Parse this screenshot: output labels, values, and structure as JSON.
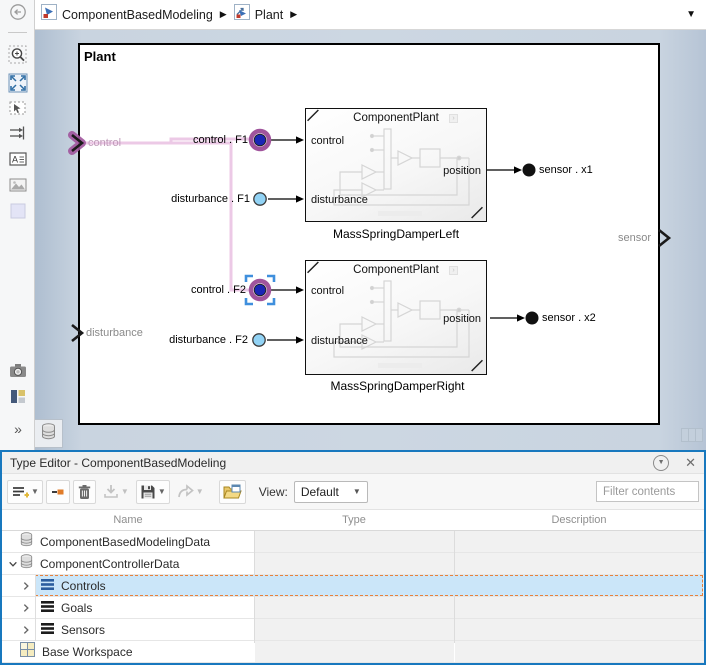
{
  "breadcrumb": {
    "items": [
      {
        "label": "ComponentBasedModeling"
      },
      {
        "label": "Plant"
      }
    ],
    "separator_icon": "▶",
    "dropdown_icon": "▼"
  },
  "left_toolbar": {
    "expand_icon": "»"
  },
  "canvas": {
    "title": "Plant",
    "edge_ports": {
      "input_control": "control",
      "input_disturbance": "disturbance",
      "output_sensor": "sensor"
    },
    "labels": {
      "control_f1": "control . F1",
      "disturbance_f1": "disturbance . F1",
      "sensor_x1": "sensor . x1",
      "control_f2": "control . F2",
      "disturbance_f2": "disturbance . F2",
      "sensor_x2": "sensor . x2"
    },
    "blocks": [
      {
        "title": "ComponentPlant",
        "caption": "MassSpringDamperLeft",
        "ports": {
          "in1": "control",
          "in2": "disturbance",
          "out": "position"
        }
      },
      {
        "title": "ComponentPlant",
        "caption": "MassSpringDamperRight",
        "ports": {
          "in1": "control",
          "in2": "disturbance",
          "out": "position"
        }
      }
    ]
  },
  "type_editor": {
    "title": "Type Editor - ComponentBasedModeling",
    "titlebar_icons": {
      "menu": "▼",
      "close": "✕"
    },
    "toolbar": {
      "view_label": "View:",
      "view_value": "Default",
      "filter_placeholder": "Filter contents"
    },
    "columns": [
      "Name",
      "Type",
      "Description"
    ],
    "rows": [
      {
        "name": "ComponentBasedModelingData",
        "icon": "data-dictionary",
        "expander": "none",
        "selected": false
      },
      {
        "name": "ComponentControllerData",
        "icon": "data-dictionary",
        "expander": "expanded",
        "selected": false
      },
      {
        "name": "Controls",
        "icon": "bus-type",
        "expander": "collapsed",
        "selected": true
      },
      {
        "name": "Goals",
        "icon": "bus-type",
        "expander": "collapsed",
        "selected": false
      },
      {
        "name": "Sensors",
        "icon": "bus-type",
        "expander": "collapsed",
        "selected": false
      },
      {
        "name": "Base Workspace",
        "icon": "workspace",
        "expander": "none",
        "selected": false
      }
    ]
  },
  "colors": {
    "panel_focus_blue": "#1878be",
    "selection_blue": "#cbe6f9",
    "selection_outline_orange": "#e8813a",
    "wire_highlight_pink": "#ecc9e6",
    "port_highlight_magenta": "#a0549c",
    "control_signal_fill": "#1a25b5",
    "disturbance_signal_fill": "#92d3f5",
    "sensor_signal_fill": "#111111"
  }
}
